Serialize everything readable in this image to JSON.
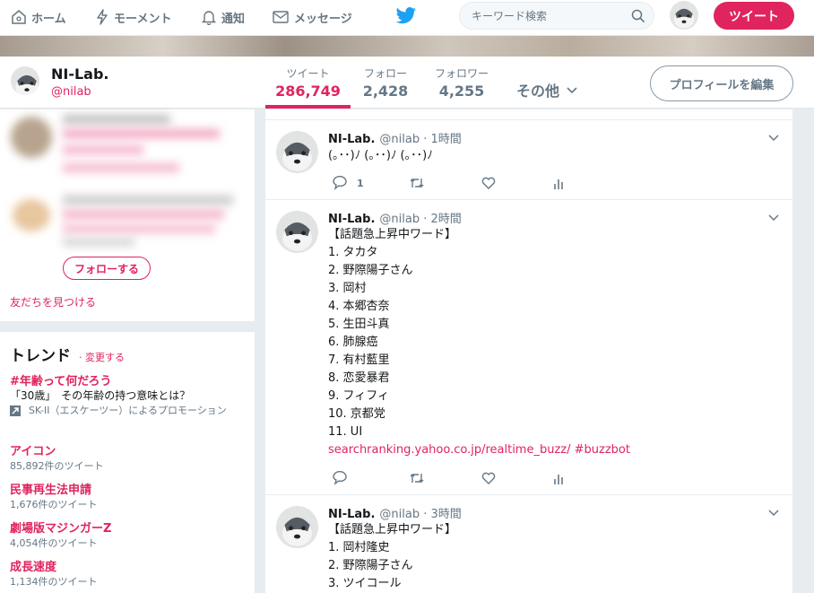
{
  "nav": {
    "home": "ホーム",
    "moments": "モーメント",
    "notifications": "通知",
    "messages": "メッセージ",
    "search_placeholder": "キーワード検索",
    "tweet_button": "ツイート"
  },
  "profile": {
    "name": "NI-Lab.",
    "handle": "@nilab",
    "stats": [
      {
        "label": "ツイート",
        "value": "286,749"
      },
      {
        "label": "フォロー",
        "value": "2,428"
      },
      {
        "label": "フォロワー",
        "value": "4,255"
      }
    ],
    "more": "その他",
    "edit_button": "プロフィールを編集"
  },
  "who_to_follow": {
    "follow_button": "フォローする",
    "find_friends": "友だちを見つける"
  },
  "trends": {
    "title": "トレンド",
    "change": "· 変更する",
    "promoted": {
      "name": "#年齢って何だろう",
      "desc": "「30歳」　その年齢の持つ意味とは？",
      "by": "SK-II（エスケーツー）によるプロモーション"
    },
    "items": [
      {
        "name": "アイコン",
        "count": "85,892件のツイート"
      },
      {
        "name": "民事再生法申請",
        "count": "1,676件のツイート"
      },
      {
        "name": "劇場版マジンガーZ",
        "count": "4,054件のツイート"
      },
      {
        "name": "成長速度",
        "count": "1,134件のツイート"
      }
    ]
  },
  "tweets": [
    {
      "name": "NI-Lab.",
      "handle": "@nilab · 1時間",
      "lines": [
        "(｡･･)ﾉ (｡･･)ﾉ (｡･･)ﾉ"
      ],
      "reply_count": "1"
    },
    {
      "name": "NI-Lab.",
      "handle": "@nilab · 2時間",
      "lines": [
        "【話題急上昇中ワード】",
        "1. タカタ",
        "2. 野際陽子さん",
        "3. 岡村",
        "4. 本郷杏奈",
        "5. 生田斗真",
        "6. 肺腺癌",
        "7. 有村藍里",
        "8. 恋愛暴君",
        "9. フィフィ",
        "10. 京都党",
        "11. UI"
      ],
      "link": "searchranking.yahoo.co.jp/realtime_buzz/ #buzzbot"
    },
    {
      "name": "NI-Lab.",
      "handle": "@nilab · 3時間",
      "lines": [
        "【話題急上昇中ワード】",
        "1. 岡村隆史",
        "2. 野際陽子さん",
        "3. ツイコール"
      ]
    }
  ],
  "colors": {
    "accent": "#e0245e",
    "twitter_blue": "#1da1f2",
    "muted": "#657786"
  }
}
